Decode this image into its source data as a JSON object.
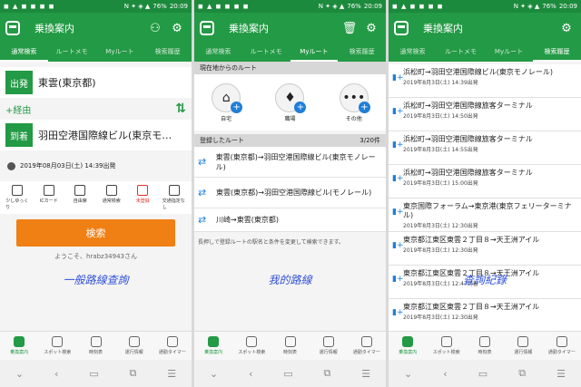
{
  "status": {
    "left": "◼ ▲ ◼ ◼ ◼ ◼",
    "icons": "N ✦ ◈ ▲",
    "battery": "76%",
    "time": "20:09"
  },
  "app": {
    "title": "乗換案内",
    "tabs": [
      "通常検索",
      "ルートメモ",
      "Myルート",
      "検索履歴"
    ]
  },
  "screen1": {
    "depart_label": "出発",
    "depart_station": "東雲(東京都)",
    "via": "+経由",
    "arrive_label": "到着",
    "arrive_station": "羽田空港国際線ビル(東京モ…",
    "datetime": "2019年08月03日(土) 14:39出発",
    "options": [
      "少しゆっくり",
      "ICカード",
      "自由席",
      "通常検索",
      "未登録",
      "交通指定なし"
    ],
    "search_label": "検索",
    "welcome": "ようこそ、hrabz34943さん",
    "overlay": "一般路線查詢"
  },
  "screen2": {
    "current_header": "現在地からのルート",
    "places": [
      {
        "label": "自宅",
        "icon": "home-icon"
      },
      {
        "label": "職場",
        "icon": "tie-icon"
      },
      {
        "label": "その他",
        "icon": "more-icon"
      }
    ],
    "registered_header": "登録したルート",
    "count": "3/20件",
    "routes": [
      "東雲(東京都)→羽田空港国際線ビル(東京モノレール)",
      "東雲(東京都)→羽田空港国際線ビル(モノレール)",
      "川崎→東雲(東京都)"
    ],
    "hint": "長押しで登録ルートの駅名と条件を変更して検索できます。",
    "overlay": "我的路線"
  },
  "screen3": {
    "history": [
      {
        "title": "浜松町→羽田空港国際線ビル(東京モノレール)",
        "date": "2019年8月3日(土) 14:39出発"
      },
      {
        "title": "浜松町→羽田空港国際線旅客ターミナル",
        "date": "2019年8月3日(土) 14:50出発"
      },
      {
        "title": "浜松町→羽田空港国際線旅客ターミナル",
        "date": "2019年8月3日(土) 14:55出発"
      },
      {
        "title": "浜松町→羽田空港国際線旅客ターミナル",
        "date": "2019年8月3日(土) 15:00出発"
      },
      {
        "title": "東京国際フォーラム→東京港(東京フェリーターミナル)",
        "date": "2019年8月3日(土) 12:30出発"
      },
      {
        "title": "東京都江東区東雲２丁目８→天王洲アイル",
        "date": "2019年8月3日(土) 12:30出発"
      },
      {
        "title": "東京都江東区東雲２丁目８→天王洲アイル",
        "date": "2019年8月3日(土) 12:47到着"
      },
      {
        "title": "東京都江東区東雲２丁目８→天王洲アイル",
        "date": "2019年8月3日(土) 12:30出発"
      }
    ],
    "overlay": "查詢紀錄"
  },
  "bottom_nav": [
    "乗換案内",
    "スポット検索",
    "時刻表",
    "運行情報",
    "通勤タイマー"
  ],
  "colors": {
    "green": "#239a45",
    "orange": "#f07f14",
    "blue": "#1f7fd8"
  }
}
